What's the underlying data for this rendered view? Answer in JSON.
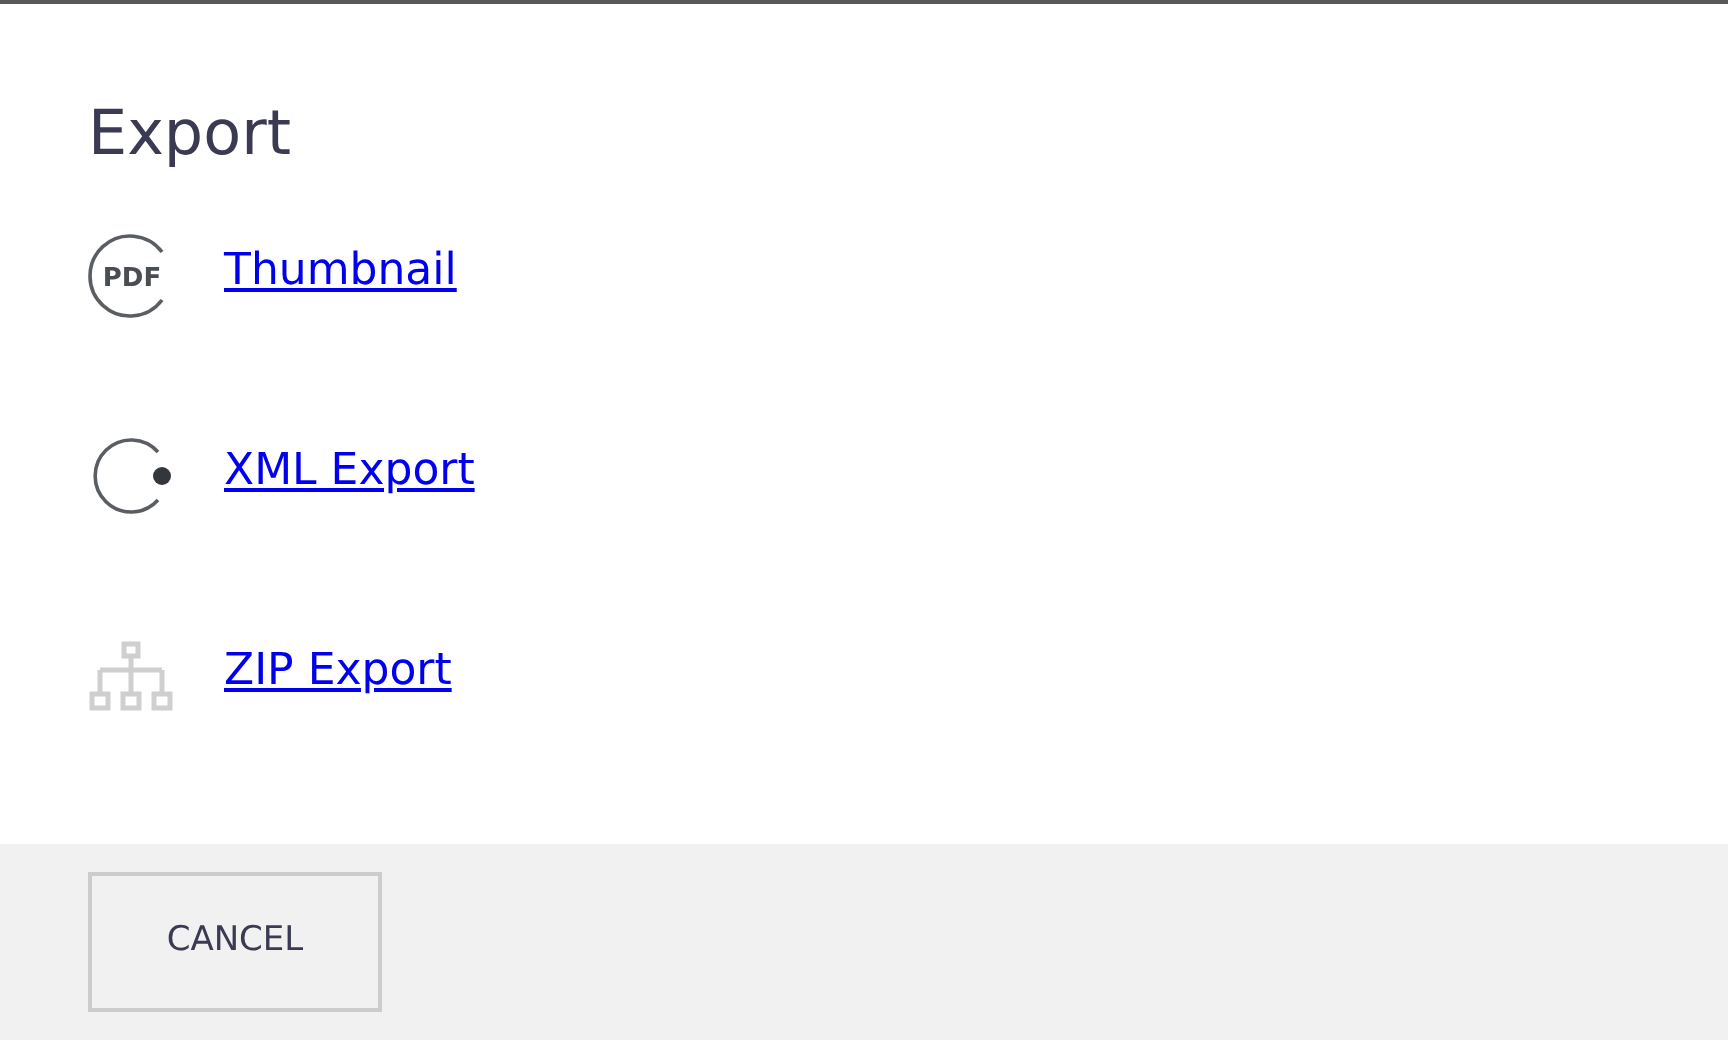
{
  "dialog": {
    "title": "Export"
  },
  "options": [
    {
      "kind": "pdf",
      "icon_text": "PDF",
      "label": "Thumbnail"
    },
    {
      "kind": "circle-dot",
      "label": "XML Export"
    },
    {
      "kind": "hierarchy",
      "label": "ZIP Export"
    }
  ],
  "buttons": [
    "CANCEL"
  ]
}
